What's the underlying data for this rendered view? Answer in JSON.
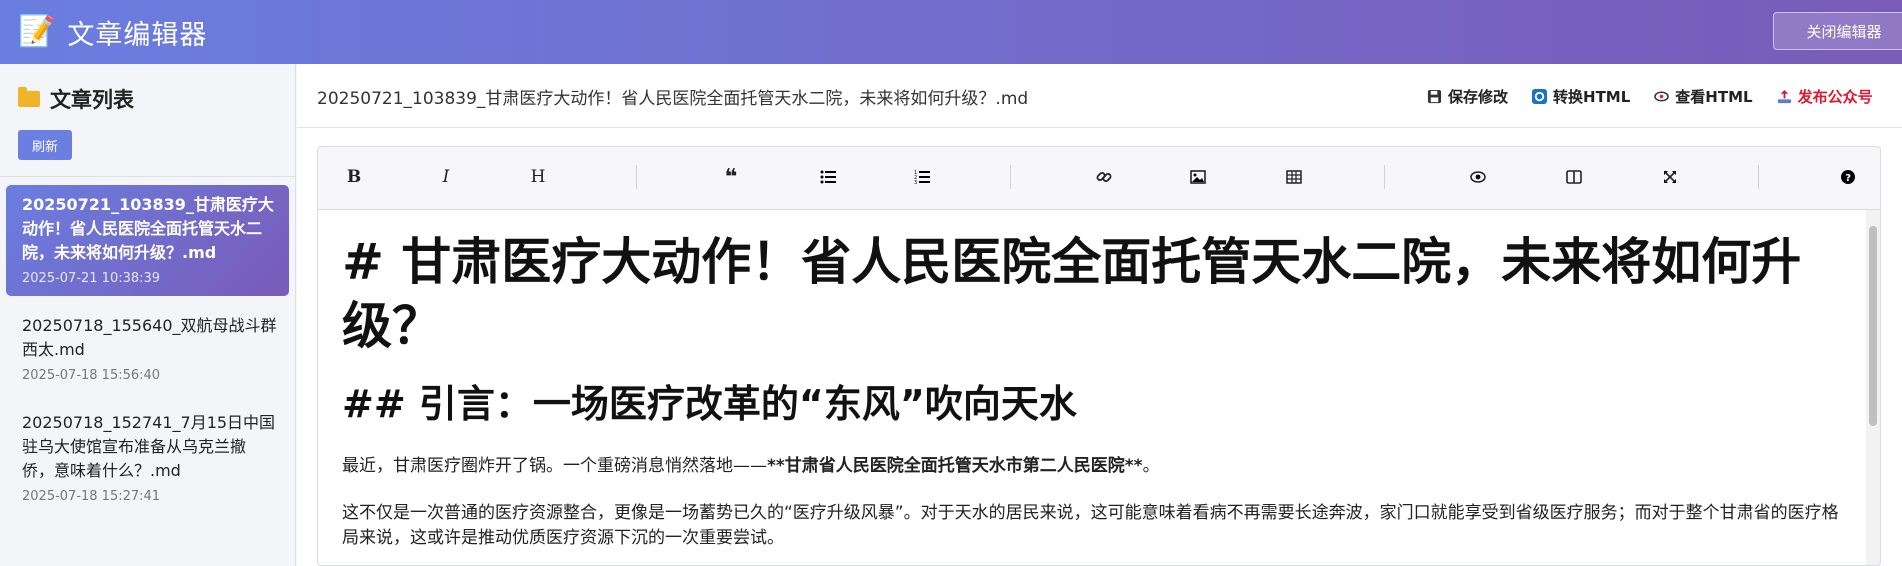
{
  "app": {
    "title": "文章编辑器",
    "close_label": "关闭编辑器"
  },
  "sidebar": {
    "title": "文章列表",
    "refresh_label": "刷新",
    "files": [
      {
        "name": "20250721_103839_甘肃医疗大动作！省人民医院全面托管天水二院，未来将如何升级？.md",
        "date": "2025-07-21 10:38:39",
        "active": true
      },
      {
        "name": "20250718_155640_双航母战斗群西太.md",
        "date": "2025-07-18 15:56:40",
        "active": false
      },
      {
        "name": "20250718_152741_7月15日中国驻乌大使馆宣布准备从乌克兰撤侨，意味着什么？.md",
        "date": "2025-07-18 15:27:41",
        "active": false
      }
    ]
  },
  "doc": {
    "filename": "20250721_103839_甘肃医疗大动作！省人民医院全面托管天水二院，未来将如何升级？.md",
    "actions": [
      {
        "label": "保存修改",
        "icon": "save-icon"
      },
      {
        "label": "转换HTML",
        "icon": "convert-icon"
      },
      {
        "label": "查看HTML",
        "icon": "eye-icon"
      },
      {
        "label": "发布公众号",
        "icon": "upload-icon",
        "color": "#e0182e"
      }
    ]
  },
  "toolbar": [
    "bold-icon",
    "italic-icon",
    "heading-icon",
    "quote-icon",
    "unordered-list-icon",
    "ordered-list-icon",
    "link-icon",
    "image-icon",
    "table-icon",
    "preview-icon",
    "side-by-side-icon",
    "fullscreen-icon",
    "help-icon"
  ],
  "content": {
    "h1": "# 甘肃医疗大动作！省人民医院全面托管天水二院，未来将如何升级？",
    "h2": "## 引言：一场医疗改革的“东风”吹向天水",
    "p1_pre": "最近，甘肃医疗圈炸开了锅。一个重磅消息悄然落地——",
    "p1_bold": "**甘肃省人民医院全面托管天水市第二人民医院**",
    "p1_post": "。",
    "p2": "这不仅是一次普通的医疗资源整合，更像是一场蓄势已久的“医疗升级风暴”。对于天水的居民来说，这可能意味着看病不再需要长途奔波，家门口就能享受到省级医疗服务；而对于整个甘肃省的医疗格局来说，这或许是推动优质医疗资源下沉的一次重要尝试。"
  },
  "colors": {
    "accent_start": "#6a7ee0",
    "accent_end": "#7a5bb8",
    "publish": "#e0182e"
  }
}
